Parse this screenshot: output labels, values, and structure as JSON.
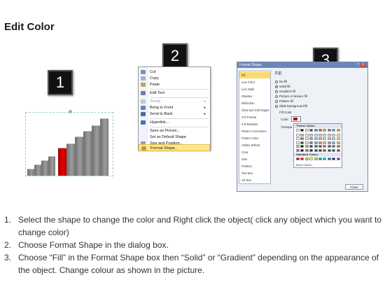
{
  "title": "Edit Color",
  "badges": {
    "one": "1",
    "two": "2",
    "three": "3"
  },
  "context_menu": {
    "items": [
      {
        "label": "Cut",
        "icon": "scissors-icon"
      },
      {
        "label": "Copy",
        "icon": "copy-icon"
      },
      {
        "label": "Paste",
        "icon": "paste-icon"
      },
      {
        "label": "Edit Text",
        "icon": "edit-text-icon"
      },
      {
        "label": "Group",
        "icon": "group-icon",
        "disabled": true
      },
      {
        "label": "Bring to Front",
        "icon": "bring-front-icon"
      },
      {
        "label": "Send to Back",
        "icon": "send-back-icon"
      },
      {
        "label": "Hyperlink...",
        "icon": "hyperlink-icon"
      },
      {
        "label": "Save as Picture...",
        "icon": ""
      },
      {
        "label": "Set as Default Shape",
        "icon": ""
      },
      {
        "label": "Size and Position...",
        "icon": "size-icon"
      },
      {
        "label": "Format Shape...",
        "icon": "format-shape-icon",
        "highlighted": true
      }
    ]
  },
  "dialog": {
    "title": "Format Shape",
    "help": "?",
    "close_x": "X",
    "categories": [
      "Fill",
      "Line Color",
      "Line Style",
      "Shadow",
      "Reflection",
      "Glow and Soft Edges",
      "3-D Format",
      "3-D Rotation",
      "Picture Corrections",
      "Picture Color",
      "Artistic Effects",
      "Crop",
      "Size",
      "Position",
      "Text Box",
      "Alt Text"
    ],
    "pane_heading": "Fill",
    "options": [
      "No fill",
      "Solid fill",
      "Gradient fill",
      "Picture or texture fill",
      "Pattern fill",
      "Slide background fill"
    ],
    "fill_color_label": "Fill Color",
    "color_label": "Color:",
    "transparency_label": "Transpa",
    "palette": {
      "theme_heading": "Theme Colors",
      "standard_heading": "Standard Colors",
      "more": "More Colors...",
      "theme_top": [
        "#ffffff",
        "#000000",
        "#eeece1",
        "#1f497d",
        "#4f81bd",
        "#c0504d",
        "#9bbb59",
        "#8064a2",
        "#4bacc6",
        "#f79646"
      ],
      "standard": [
        "#c00000",
        "#ff0000",
        "#ffc000",
        "#ffff00",
        "#92d050",
        "#00b050",
        "#00b0f0",
        "#0070c0",
        "#002060",
        "#7030a0"
      ]
    },
    "close_button": "Close"
  },
  "instructions": [
    {
      "num": "1.",
      "text": "Select the shape to change the color and Right click the object( click any object which you want to change color)"
    },
    {
      "num": "2.",
      "text": "Choose Format Shape in the dialog box."
    },
    {
      "num": "3.",
      "text": "Choose “Fill” in the Format Shape box then “Solid” or “Gradient” depending on the appearance of the object. Change colour as shown in the picture."
    }
  ]
}
